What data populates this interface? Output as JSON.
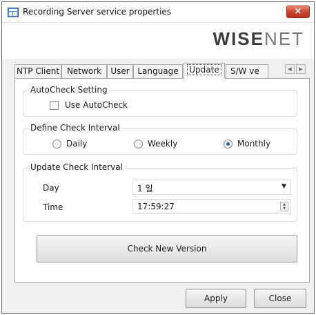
{
  "window": {
    "title": "Recording Server service properties",
    "close_glyph": "×",
    "brand_logo": {
      "part1": "W",
      "part2": "ISE",
      "part3": "NET"
    }
  },
  "tabs": [
    {
      "label": "NTP Client",
      "active": false
    },
    {
      "label": "Network",
      "active": false
    },
    {
      "label": "User",
      "active": false
    },
    {
      "label": "Language",
      "active": false
    },
    {
      "label": "Update",
      "active": true
    },
    {
      "label": "S/W ve",
      "active": false
    }
  ],
  "tab_scroll": {
    "left": "◀",
    "right": "▶"
  },
  "autocheck": {
    "legend": "AutoCheck Setting",
    "use_label": "Use AutoCheck",
    "checked": false
  },
  "check_interval": {
    "legend": "Define Check Interval",
    "options": [
      {
        "label": "Daily",
        "checked": false
      },
      {
        "label": "Weekly",
        "checked": false
      },
      {
        "label": "Monthly",
        "checked": true
      }
    ]
  },
  "update_interval": {
    "legend": "Update Check Interval",
    "day_label": "Day",
    "day_value": "1 일",
    "time_label": "Time",
    "time_value": "17:59:27"
  },
  "actions": {
    "check_new_version": "Check New Version",
    "apply": "Apply",
    "close": "Close"
  },
  "colors": {
    "close_button": "#c7432f",
    "radio_selected": "#2a5fb0",
    "border": "#a6a6a6"
  }
}
